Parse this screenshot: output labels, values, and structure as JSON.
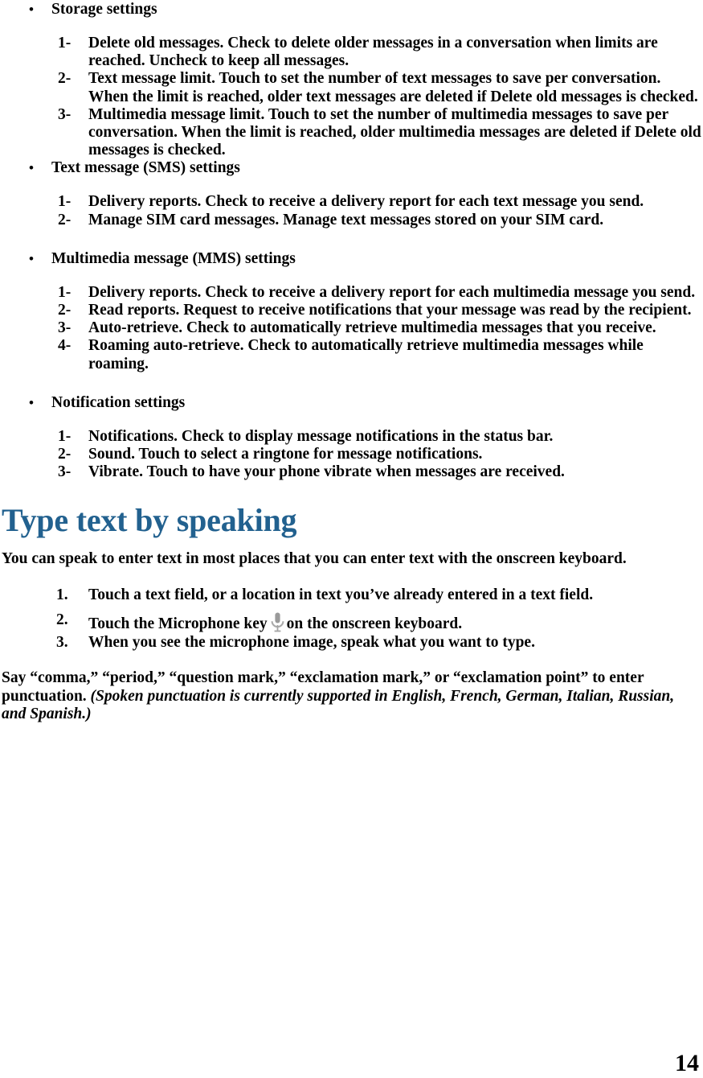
{
  "document": {
    "page_number": "14",
    "heading_color": "#22618F"
  },
  "sections": [
    {
      "bullet": "•",
      "title": "Storage settings",
      "items": [
        {
          "marker": "1-",
          "text": "Delete old messages. Check to delete older messages in a conversation when limits are reached. Uncheck to keep all messages."
        },
        {
          "marker": "2-",
          "text": "Text message limit. Touch to set the number of text messages to save per conversation. When the limit is reached, older text messages are deleted if Delete old messages is checked."
        },
        {
          "marker": "3-",
          "text": "Multimedia message limit. Touch to set the number of multimedia messages to save per conversation. When the limit is reached, older multimedia messages are deleted if Delete old messages is checked."
        }
      ]
    },
    {
      "bullet": "•",
      "title": "Text message (SMS) settings",
      "items": [
        {
          "marker": "1-",
          "text": "Delivery reports. Check to receive a delivery report for each text message you send."
        },
        {
          "marker": "2-",
          "text": "Manage SIM card messages. Manage text messages stored on your SIM card."
        }
      ]
    },
    {
      "bullet": "•",
      "title": "Multimedia message (MMS) settings",
      "items": [
        {
          "marker": "1-",
          "text": "Delivery reports. Check to receive a delivery report for each multimedia message you send."
        },
        {
          "marker": "2-",
          "text": "Read reports. Request to receive notifications that your message was read by the recipient."
        },
        {
          "marker": "3-",
          "text": "Auto-retrieve. Check to automatically retrieve multimedia messages that you receive."
        },
        {
          "marker": "4-",
          "text": "Roaming auto-retrieve. Check to automatically retrieve multimedia messages while roaming."
        }
      ]
    },
    {
      "bullet": "•",
      "title": "Notification settings",
      "items": [
        {
          "marker": "1-",
          "text": "Notifications. Check to display message notifications in the status bar."
        },
        {
          "marker": "2-",
          "text": "Sound. Touch to select a ringtone for message notifications."
        },
        {
          "marker": "3-",
          "text": "Vibrate. Touch to have your phone vibrate when messages are received."
        }
      ]
    }
  ],
  "speaking": {
    "heading": "Type text by speaking",
    "intro": "You can speak to enter text in most places that you can enter text with the onscreen keyboard.",
    "steps": [
      {
        "marker": "1.",
        "text": "Touch a text field, or a location in text you’ve already entered in a text field."
      },
      {
        "marker": "2.",
        "text_before": "Touch the Microphone key",
        "icon": "microphone-icon",
        "text_after": "on the onscreen keyboard."
      },
      {
        "marker": "3.",
        "text": "When you see the microphone image, speak what you want to type."
      }
    ],
    "punctuation_note_plain": "Say “comma,” “period,” “question mark,” “exclamation mark,” or “exclamation point” to enter punctuation. ",
    "punctuation_note_italic": "(Spoken punctuation is currently supported in English, French, German, Italian, Russian, and Spanish.)"
  }
}
